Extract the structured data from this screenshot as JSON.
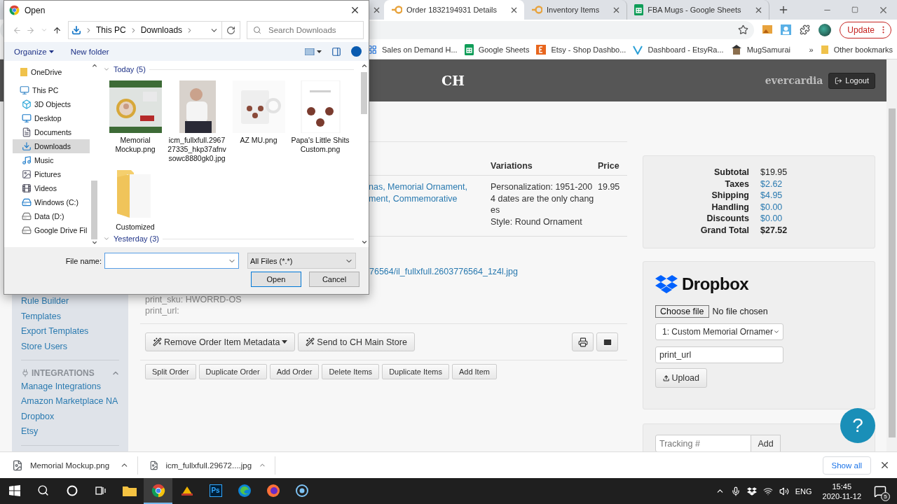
{
  "browser": {
    "tabs": [
      {
        "title": "Order 1832194931 Details",
        "kind": "app",
        "selected": true
      },
      {
        "title": "Inventory Items",
        "kind": "app",
        "selected": false
      },
      {
        "title": "FBA Mugs - Google Sheets",
        "kind": "sheets",
        "selected": false
      }
    ],
    "update_button": "Update",
    "bookmarks": [
      {
        "label": "Sales on Demand H...",
        "kind": "grid"
      },
      {
        "label": "Google Sheets",
        "kind": "sheets"
      },
      {
        "label": "Etsy - Shop Dashbo...",
        "kind": "etsy"
      },
      {
        "label": "Dashboard - EtsyRa...",
        "kind": "rank"
      },
      {
        "label": "MugSamurai",
        "kind": "samurai"
      }
    ],
    "more_bookmarks": "»",
    "other_bookmarks": "Other bookmarks"
  },
  "page": {
    "header": {
      "brand": "CH",
      "user": "evercardia",
      "logout": "Logout"
    },
    "sidebar": {
      "items": [
        "Rule Builder",
        "Templates",
        "Export Templates",
        "Store Users"
      ],
      "section": {
        "title": "INTEGRATIONS",
        "expanded": true,
        "items": [
          "Manage Integrations",
          "Amazon Marketplace NA",
          "Dropbox",
          "Etsy"
        ]
      }
    },
    "items_table": {
      "columns": [
        "Variations",
        "Price"
      ],
      "row": {
        "title_lines": [
          "nas, Memorial Ornament,",
          "ment, Commemorative"
        ],
        "variations": [
          "Personalization: 1951-2004 dates are the only changes",
          "Style: Round Ornament"
        ],
        "price": "19.95"
      }
    },
    "image_link": "76564/il_fullxfull.2603776564_1z4l.jpg",
    "metadata": [
      "print_sku: HWORRD-OS",
      "print_url:"
    ],
    "action_buttons": [
      {
        "label": "Remove Order Item Metadata",
        "kind": "dropdown"
      },
      {
        "label": "Send to CH Main Store",
        "kind": "plain"
      }
    ],
    "order_buttons": [
      "Split Order",
      "Duplicate Order",
      "Add Order",
      "Delete Items",
      "Duplicate Items",
      "Add Item"
    ],
    "totals": [
      {
        "label": "Subtotal",
        "value": "$19.95",
        "kind": "plain"
      },
      {
        "label": "Taxes",
        "value": "$2.62",
        "kind": "link"
      },
      {
        "label": "Shipping",
        "value": "$4.95",
        "kind": "link"
      },
      {
        "label": "Handling",
        "value": "$0.00",
        "kind": "link"
      },
      {
        "label": "Discounts",
        "value": "$0.00",
        "kind": "link"
      },
      {
        "label": "Grand Total",
        "value": "$27.52",
        "kind": "total"
      }
    ],
    "dropbox": {
      "logo": "Dropbox",
      "file_button": "Choose file",
      "file_status": "No file chosen",
      "item_select": "1: Custom Memorial Ornamer",
      "field_value": "print_url",
      "upload": "Upload"
    },
    "tracking": {
      "placeholder": "Tracking #",
      "add": "Add"
    },
    "help": "?"
  },
  "dialog": {
    "title": "Open",
    "breadcrumb": [
      "This PC",
      "Downloads"
    ],
    "search": {
      "placeholder": "Search Downloads"
    },
    "toolbar": {
      "organize": "Organize",
      "new_folder": "New folder"
    },
    "nav_items": [
      {
        "label": "OneDrive",
        "kind": "cloud",
        "selected": false
      },
      {
        "label": "This PC",
        "kind": "pc",
        "selected": false,
        "children": [
          {
            "label": "3D Objects",
            "kind": "cube",
            "selected": false
          },
          {
            "label": "Desktop",
            "kind": "desktop",
            "selected": false
          },
          {
            "label": "Documents",
            "kind": "documents",
            "selected": false
          },
          {
            "label": "Downloads",
            "kind": "downloads",
            "selected": true
          },
          {
            "label": "Music",
            "kind": "music",
            "selected": false
          },
          {
            "label": "Pictures",
            "kind": "pictures",
            "selected": false
          },
          {
            "label": "Videos",
            "kind": "videos",
            "selected": false
          },
          {
            "label": "Windows (C:)",
            "kind": "system-drive",
            "selected": false
          },
          {
            "label": "Data (D:)",
            "kind": "drive",
            "selected": false
          },
          {
            "label": "Google Drive Fil",
            "kind": "drive",
            "selected": false
          }
        ]
      }
    ],
    "groups": [
      {
        "label": "Today (5)",
        "expanded": true,
        "files": [
          {
            "name": "Memorial Mockup.png",
            "kind": "picture"
          },
          {
            "name": "icm_fullxfull.296727335_hkp37afnvsowc8880gk0.jpg",
            "kind": "picture"
          },
          {
            "name": "AZ MU.png",
            "kind": "picture"
          },
          {
            "name": "Papa's Little Shits Custom.png",
            "kind": "picture"
          },
          {
            "name": "Customized",
            "kind": "folder"
          }
        ]
      },
      {
        "label": "Yesterday (3)",
        "expanded": true
      }
    ],
    "file_name_label": "File name:",
    "file_type": "All Files (*.*)",
    "open_button": "Open",
    "cancel_button": "Cancel"
  },
  "downloads": {
    "items": [
      "Memorial Mockup.png",
      "icm_fullxfull.29672....jpg"
    ],
    "show_all": "Show all"
  },
  "taskbar": {
    "apps": [
      {
        "kind": "start",
        "active": false
      },
      {
        "kind": "search",
        "active": false
      },
      {
        "kind": "cortana",
        "active": false
      },
      {
        "kind": "taskview",
        "active": false
      },
      {
        "kind": "explorer",
        "active": false
      },
      {
        "kind": "chrome",
        "active": true
      },
      {
        "kind": "app",
        "active": false
      },
      {
        "kind": "photoshop",
        "label": "Ps",
        "active": false
      },
      {
        "kind": "edge",
        "active": false
      },
      {
        "kind": "firefox",
        "active": false
      },
      {
        "kind": "recorder",
        "active": false
      }
    ],
    "tray": {
      "language": "ENG",
      "time": "15:45",
      "date": "2020-11-12",
      "notifications": "5"
    }
  }
}
